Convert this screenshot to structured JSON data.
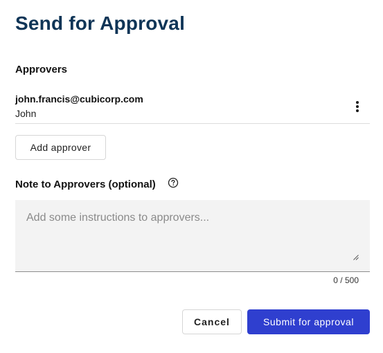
{
  "dialog": {
    "title": "Send for Approval"
  },
  "approvers": {
    "label": "Approvers",
    "items": [
      {
        "email": "john.francis@cubicorp.com",
        "name": "John",
        "menu_icon": "more-vertical-icon"
      }
    ],
    "add_button_label": "Add approver"
  },
  "note": {
    "label": "Note to Approvers (optional)",
    "help_icon": "question-circle-icon",
    "value": "",
    "placeholder": "Add some instructions to approvers...",
    "counter": "0 / 500"
  },
  "actions": {
    "cancel_label": "Cancel",
    "submit_label": "Submit for approval"
  },
  "colors": {
    "title": "#0f3557",
    "primary": "#2f3fcf",
    "field_bg": "#f3f3f3"
  }
}
